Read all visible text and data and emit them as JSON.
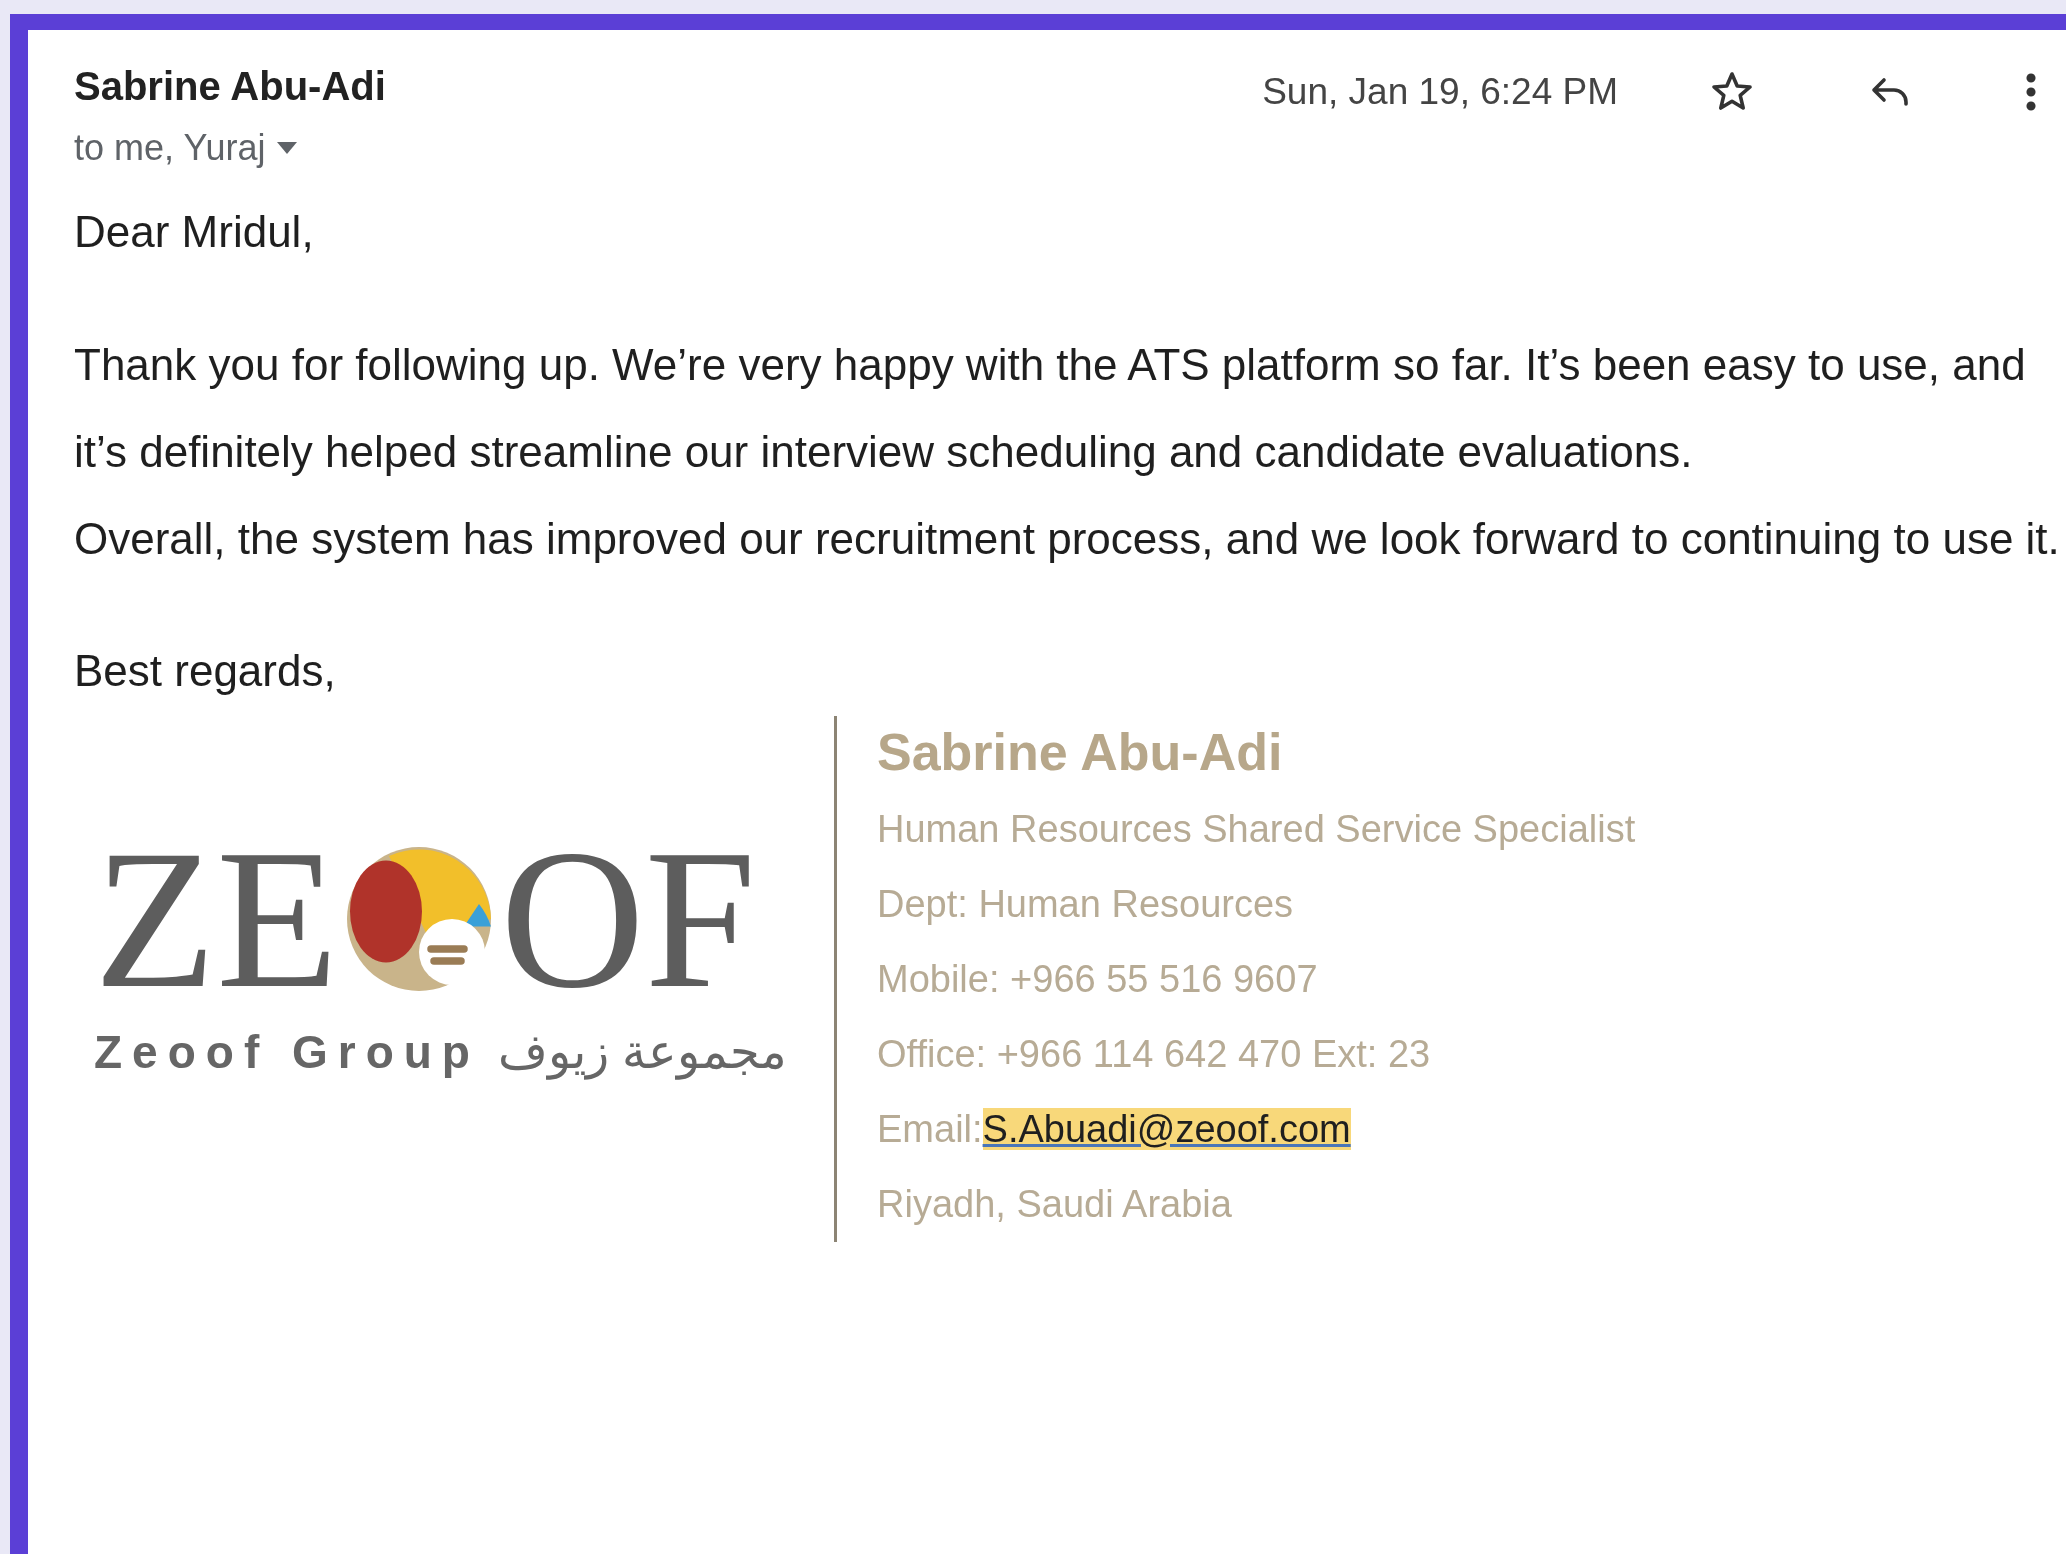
{
  "header": {
    "sender": "Sabrine Abu-Adi",
    "recipients": "to me, Yuraj",
    "date": "Sun, Jan 19, 6:24 PM"
  },
  "body": {
    "greeting": "Dear Mridul,",
    "paragraphs": [
      "Thank you for following up. We’re very happy with the ATS platform so far. It’s been easy to use, and it’s definitely helped streamline our interview scheduling and candidate evaluations.",
      "Overall, the system has improved our recruitment process, and we look forward to continuing to use it."
    ],
    "closing": "Best regards,"
  },
  "signature": {
    "logo": {
      "left": "ZE",
      "right": "OF",
      "tagline": "Zeoof Group",
      "tagline_arabic": "مجموعة زيوف"
    },
    "name": "Sabrine Abu-Adi",
    "lines": [
      {
        "kind": "text",
        "text": "Human Resources Shared Service Specialist"
      },
      {
        "kind": "text",
        "text": "Dept: Human Resources"
      },
      {
        "kind": "text",
        "text": "Mobile: +966 55 516 9607"
      },
      {
        "kind": "text",
        "text": "Office: +966 114 642 470 Ext: 23"
      },
      {
        "kind": "link",
        "label": "Email:",
        "text": "S.Abuadi@zeoof.com"
      },
      {
        "kind": "text",
        "text": "Riyadh, Saudi Arabia"
      }
    ]
  }
}
